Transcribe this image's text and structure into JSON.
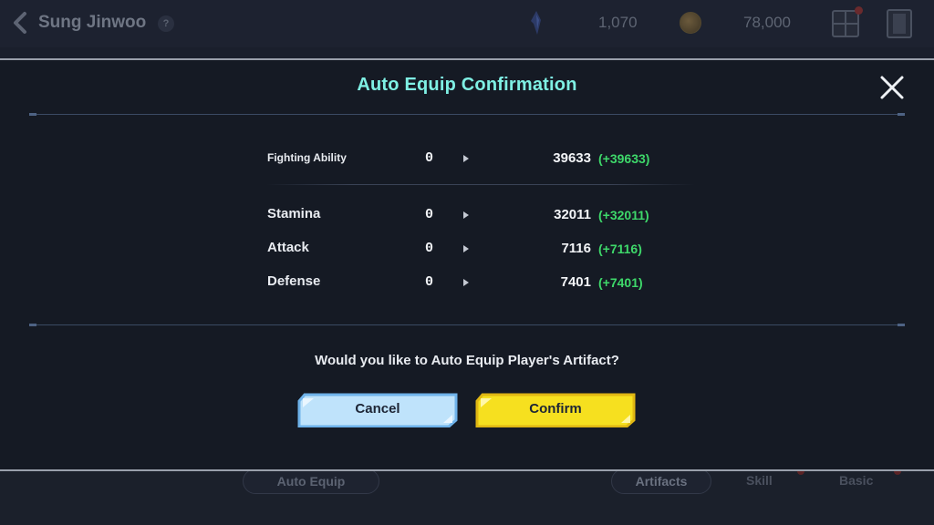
{
  "topbar": {
    "player_name": "Sung Jinwoo",
    "help_label": "?",
    "crystal_value": "1,070",
    "gold_value": "78,000"
  },
  "modal": {
    "title": "Auto Equip Confirmation",
    "stats": [
      {
        "label": "Fighting Ability",
        "old": "0",
        "new": "39633",
        "diff": "(+39633)"
      },
      {
        "label": "Stamina",
        "old": "0",
        "new": "32011",
        "diff": "(+32011)"
      },
      {
        "label": "Attack",
        "old": "0",
        "new": "7116",
        "diff": "(+7116)"
      },
      {
        "label": "Defense",
        "old": "0",
        "new": "7401",
        "diff": "(+7401)"
      }
    ],
    "question": "Would you like to Auto Equip Player's Artifact?",
    "cancel_label": "Cancel",
    "confirm_label": "Confirm"
  },
  "bottombar": {
    "auto_equip_label": "Auto Equip",
    "tabs": [
      "Artifacts",
      "Skill",
      "Basic"
    ]
  },
  "colors": {
    "title": "#7ff0e4",
    "diff": "#3ed86a",
    "cancel_fill": "#bfe3fb",
    "confirm_fill": "#f6e01f"
  }
}
